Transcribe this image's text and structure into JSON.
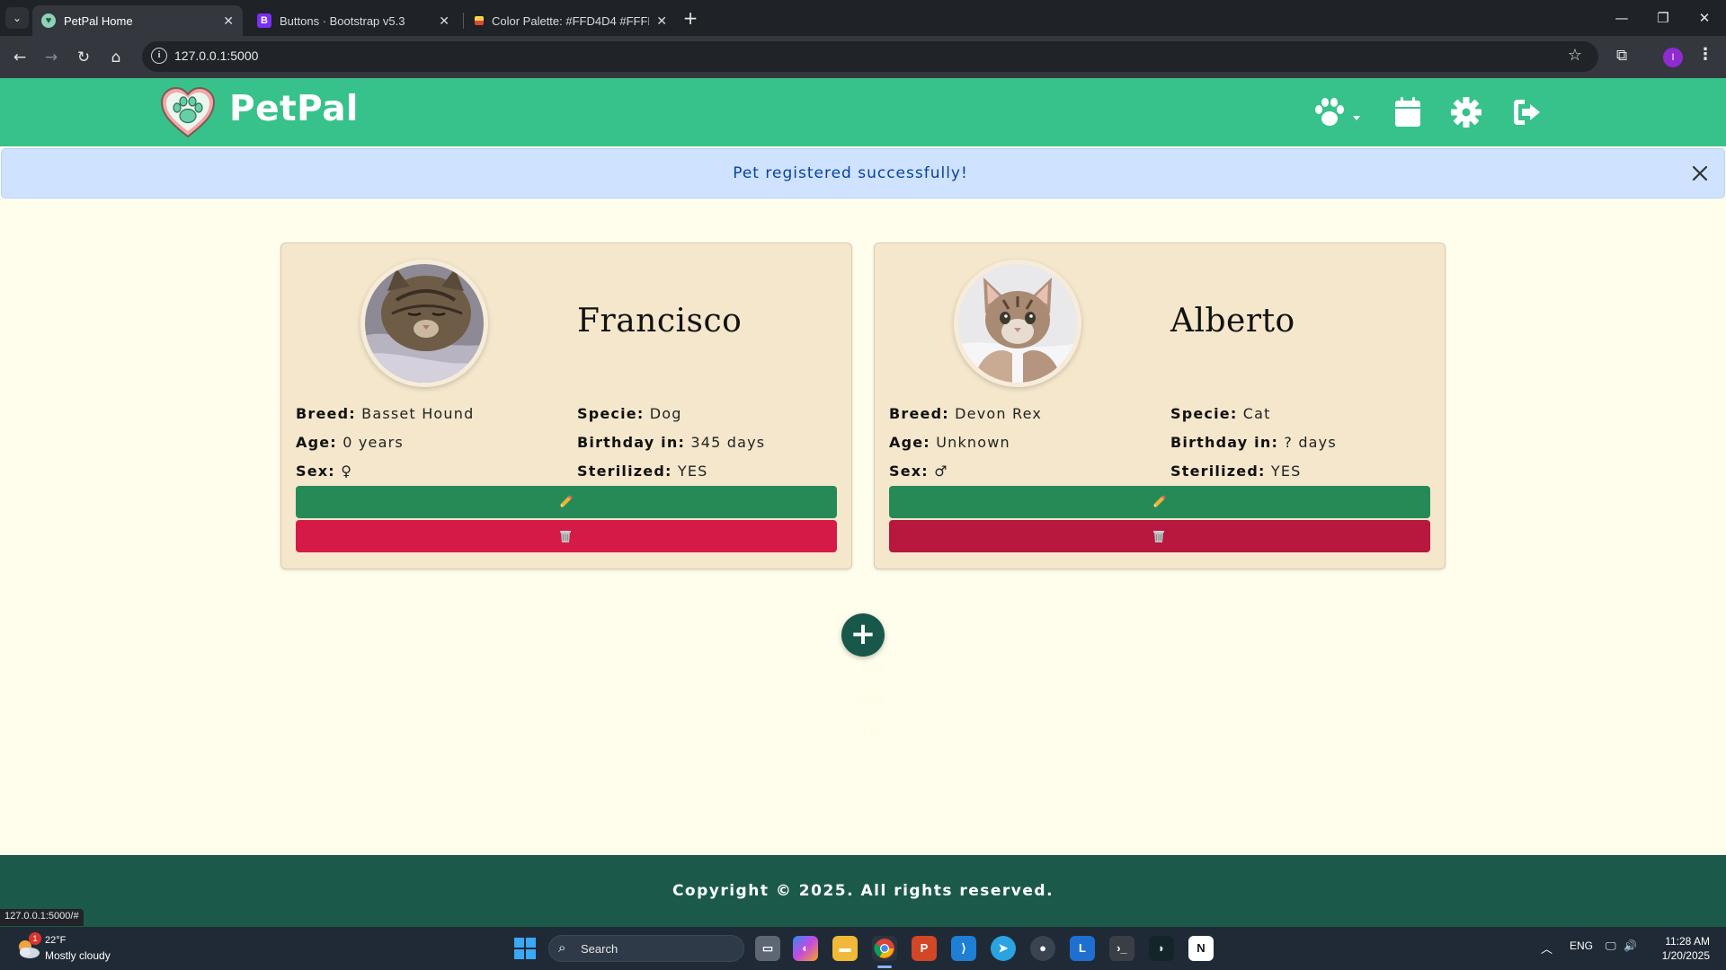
{
  "browser": {
    "tabs": [
      {
        "title": "PetPal Home",
        "active": true
      },
      {
        "title": "Buttons · Bootstrap v5.3",
        "active": false
      },
      {
        "title": "Color Palette: #FFD4D4 #FFFFE",
        "active": false
      }
    ],
    "url": "127.0.0.1:5000",
    "profile_initial": "I",
    "status_url": "127.0.0.1:5000/#"
  },
  "navbar": {
    "brand": "PetPal",
    "icons": [
      "paw-icon",
      "calendar-icon",
      "gear-icon",
      "logout-icon"
    ]
  },
  "alert": {
    "message": "Pet registered successfully!"
  },
  "labels": {
    "breed": "Breed:",
    "specie": "Specie:",
    "age": "Age:",
    "birthday": "Birthday in:",
    "sex": "Sex:",
    "sterilized": "Sterilized:"
  },
  "pets": [
    {
      "name": "Francisco",
      "breed": "Basset Hound",
      "specie": "Dog",
      "age": "0 years",
      "birthday": "345 days",
      "sex": "♀",
      "sterilized": "YES"
    },
    {
      "name": "Alberto",
      "breed": "Devon Rex",
      "specie": "Cat",
      "age": "Unknown",
      "birthday": "? days",
      "sex": "♂",
      "sterilized": "YES"
    }
  ],
  "add_button": {
    "symbol": "+",
    "ghost_lines": [
      "Add",
      "New",
      "Pet"
    ]
  },
  "footer": {
    "text": "Copyright © 2025. All rights reserved."
  },
  "taskbar": {
    "weather_temp": "22°F",
    "weather_desc": "Mostly cloudy",
    "weather_badge": "1",
    "search_label": "Search",
    "language": "ENG",
    "time": "11:28 AM",
    "date": "1/20/2025"
  },
  "colors": {
    "navbar": "#38c28b",
    "page_bg": "#fffdec",
    "card_bg": "#f4e7cc",
    "edit_button": "#268a57",
    "delete_button": "#d61a48",
    "footer": "#1b5a4b",
    "alert_bg": "#cfe2ff"
  }
}
